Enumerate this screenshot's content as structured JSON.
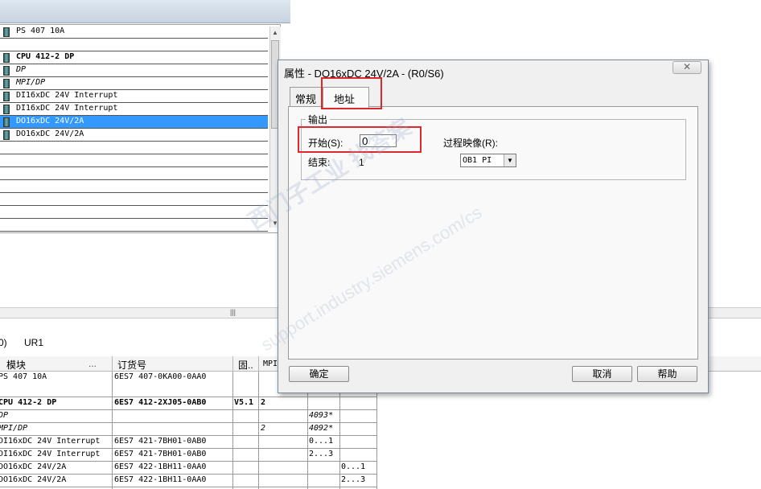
{
  "rack": {
    "slots": [
      {
        "label": "PS 407 10A",
        "style": "normal"
      },
      {
        "label": "",
        "style": "empty"
      },
      {
        "label": "CPU 412-2 DP",
        "style": "bold"
      },
      {
        "label": "DP",
        "style": "italic"
      },
      {
        "label": "MPI/DP",
        "style": "italic"
      },
      {
        "label": "DI16xDC 24V Interrupt",
        "style": "normal"
      },
      {
        "label": "DI16xDC 24V Interrupt",
        "style": "normal"
      },
      {
        "label": "DO16xDC 24V/2A",
        "style": "selected"
      },
      {
        "label": "DO16xDC 24V/2A",
        "style": "normal"
      }
    ]
  },
  "detail": {
    "rack_id": "0)",
    "rack_name": "UR1",
    "columns": {
      "module": "模块",
      "dots": "...",
      "order_no": "订货号",
      "firmware": "固..",
      "mpi": "MPI"
    },
    "rows": [
      {
        "module": "PS 407 10A",
        "order": "6ES7 407-0KA00-0AA0",
        "fw": "",
        "mpi": "",
        "iaddr": "",
        "qaddr": ""
      },
      {
        "module": "CPU 412-2 DP",
        "order": "6ES7 412-2XJ05-0AB0",
        "fw": "V5.1",
        "mpi": "2",
        "iaddr": "",
        "qaddr": ""
      },
      {
        "module": "DP",
        "order": "",
        "fw": "",
        "mpi": "",
        "iaddr": "4093*",
        "qaddr": ""
      },
      {
        "module": "MPI/DP",
        "order": "",
        "fw": "",
        "mpi": "2",
        "iaddr": "4092*",
        "qaddr": ""
      },
      {
        "module": "DI16xDC 24V Interrupt",
        "order": "6ES7 421-7BH01-0AB0",
        "fw": "",
        "mpi": "",
        "iaddr": "0...1",
        "qaddr": ""
      },
      {
        "module": "DI16xDC 24V Interrupt",
        "order": "6ES7 421-7BH01-0AB0",
        "fw": "",
        "mpi": "",
        "iaddr": "2...3",
        "qaddr": ""
      },
      {
        "module": "DO16xDC 24V/2A",
        "order": "6ES7 422-1BH11-0AA0",
        "fw": "",
        "mpi": "",
        "iaddr": "",
        "qaddr": "0...1"
      },
      {
        "module": "DO16xDC 24V/2A",
        "order": "6ES7 422-1BH11-0AA0",
        "fw": "",
        "mpi": "",
        "iaddr": "",
        "qaddr": "2...3"
      }
    ]
  },
  "dialog": {
    "title": "属性 - DO16xDC 24V/2A - (R0/S6)",
    "close_glyph": "✕",
    "tabs": {
      "general": "常规",
      "address": "地址"
    },
    "group_title": "输出",
    "start_label": "开始(S):",
    "start_value": "0",
    "end_label": "结束:",
    "end_value": "1",
    "process_image_label": "过程映像(R):",
    "process_image_value": "OB1 PI",
    "ok_label": "确定",
    "cancel_label": "取消",
    "help_label": "帮助"
  },
  "watermark": {
    "line1": "西门子工业   找答案",
    "line2": "support.industry.siemens.com/cs"
  },
  "colors": {
    "selection": "#3399ff",
    "highlight_box": "#e0282c"
  }
}
